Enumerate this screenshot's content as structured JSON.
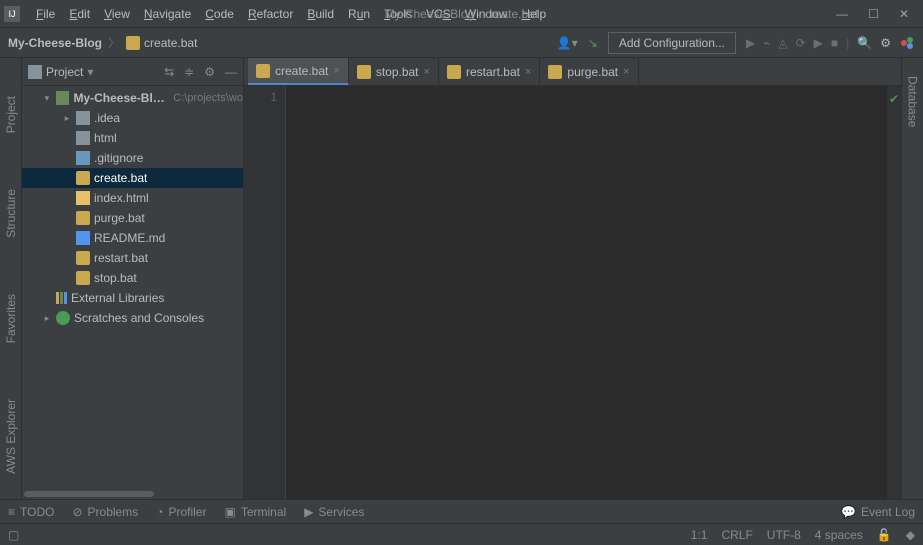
{
  "window": {
    "title": "My-Cheese-Blog - create.bat"
  },
  "menu": {
    "file": "File",
    "edit": "Edit",
    "view": "View",
    "navigate": "Navigate",
    "code": "Code",
    "refactor": "Refactor",
    "build": "Build",
    "run": "Run",
    "tools": "Tools",
    "vcs": "VCS",
    "window": "Window",
    "help": "Help"
  },
  "breadcrumb": {
    "project": "My-Cheese-Blog",
    "file": "create.bat"
  },
  "toolbar": {
    "config_label": "Add Configuration..."
  },
  "left_tools": {
    "project": "Project",
    "structure": "Structure",
    "favorites": "Favorites",
    "aws": "AWS Explorer"
  },
  "right_tools": {
    "database": "Database"
  },
  "sidebar": {
    "view_label": "Project"
  },
  "tree": {
    "root": {
      "label": "My-Cheese-Blog",
      "path": "C:\\projects\\wo"
    },
    "items": [
      {
        "label": ".idea"
      },
      {
        "label": "html"
      },
      {
        "label": ".gitignore"
      },
      {
        "label": "create.bat"
      },
      {
        "label": "index.html"
      },
      {
        "label": "purge.bat"
      },
      {
        "label": "README.md"
      },
      {
        "label": "restart.bat"
      },
      {
        "label": "stop.bat"
      }
    ],
    "external": "External Libraries",
    "scratches": "Scratches and Consoles"
  },
  "tabs": [
    {
      "label": "create.bat"
    },
    {
      "label": "stop.bat"
    },
    {
      "label": "restart.bat"
    },
    {
      "label": "purge.bat"
    }
  ],
  "editor": {
    "line1": "1"
  },
  "bottom": {
    "todo": "TODO",
    "problems": "Problems",
    "profiler": "Profiler",
    "terminal": "Terminal",
    "services": "Services",
    "eventlog": "Event Log"
  },
  "status": {
    "pos": "1:1",
    "eol": "CRLF",
    "enc": "UTF-8",
    "indent": "4 spaces"
  }
}
